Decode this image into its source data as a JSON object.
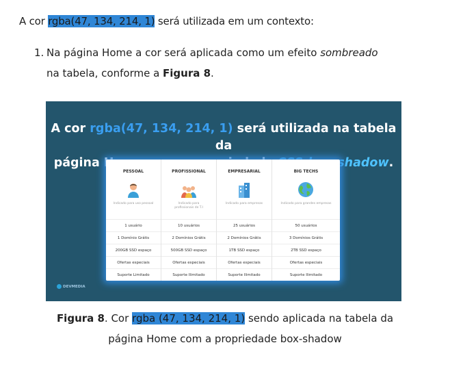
{
  "intro": {
    "before": "A cor ",
    "highlight": "rgba(47, 134, 214, 1)",
    "after": " será utilizada em um contexto:"
  },
  "item": {
    "number": "1.",
    "line1_before": "Na página Home a cor será aplicada como um efeito ",
    "line1_italic": "sombreado",
    "line2_before": "na tabela, conforme a ",
    "line2_bold": "Figura 8",
    "line2_after": "."
  },
  "figure": {
    "title_before": "A cor ",
    "title_highlight": "rgba(47, 134, 214, 1)",
    "title_mid": " será utilizada na tabela da",
    "title_line2": "página Home com a propriedade ",
    "title_css": "CSS ",
    "title_prop": "box-shadow",
    "title_end": ".",
    "logo_text": "DEVMEDIA",
    "columns": [
      {
        "header": "PESSOAL",
        "icon": "person-icon",
        "desc": "Indicado para uso pessoal",
        "rows": [
          "1 usuário",
          "1 Domínio Grátis",
          "200GB SSD espaço",
          "Ofertas especiais",
          "Suporte Limitado"
        ]
      },
      {
        "header": "PROFISSIONAL",
        "icon": "group-icon",
        "desc": "Indicado para profissionais de T.I",
        "rows": [
          "10 usuários",
          "2 Domínios Grátis",
          "500GB SSD espaço",
          "Ofertas especiais",
          "Suporte Ilimitado"
        ]
      },
      {
        "header": "EMPRESARIAL",
        "icon": "building-icon",
        "desc": "Indicado para empresas",
        "rows": [
          "25 usuários",
          "2 Domínios Grátis",
          "1TB SSD espaço",
          "Ofertas especiais",
          "Suporte Ilimitado"
        ]
      },
      {
        "header": "BIG TECHS",
        "icon": "globe-icon",
        "desc": "Indicado para grandes empresas",
        "rows": [
          "50 usuários",
          "3 Domínios Grátis",
          "2TB SSD espaço",
          "Ofertas especiais",
          "Suporte Ilimitado"
        ]
      }
    ]
  },
  "caption": {
    "label": "Figura 8",
    "before": ". Cor ",
    "highlight": "rgba (47, 134, 214, 1)",
    "after": " sendo aplicada na tabela da",
    "line2": "página Home com a propriedade box-shadow"
  }
}
